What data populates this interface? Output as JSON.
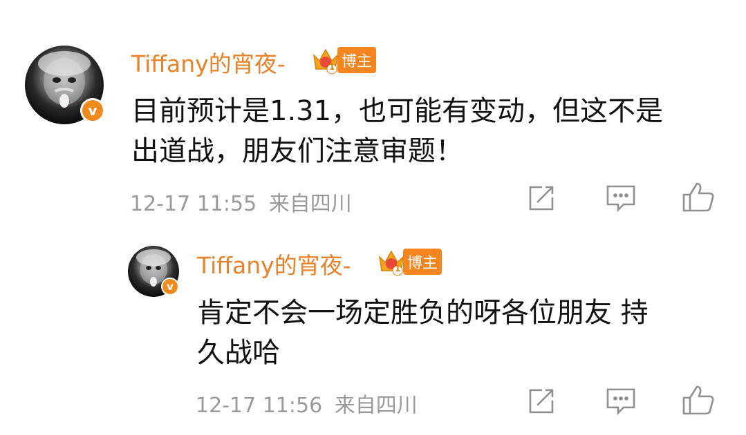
{
  "comments": [
    {
      "username": "Tiffany的宵夜-",
      "badge": "博主",
      "badge_level": "1",
      "verified_mark": "v",
      "text_lines": [
        "目前预计是1.31，也可能有变动，但这不是",
        "出道战，朋友们注意审题！"
      ],
      "time": "12-17 11:55",
      "location": "来自四川"
    },
    {
      "username": "Tiffany的宵夜-",
      "badge": "博主",
      "badge_level": "1",
      "verified_mark": "v",
      "text_lines": [
        "肯定不会一场定胜负的呀各位朋友 持",
        "久战哈"
      ],
      "time": "12-17 11:56",
      "location": "来自四川"
    }
  ],
  "colors": {
    "username": "#e8822a",
    "badge_bg": "#f5851f",
    "meta_gray": "#999999",
    "icon_gray": "#8f8f8f"
  },
  "icons": [
    "share-icon",
    "comment-icon",
    "like-icon"
  ]
}
